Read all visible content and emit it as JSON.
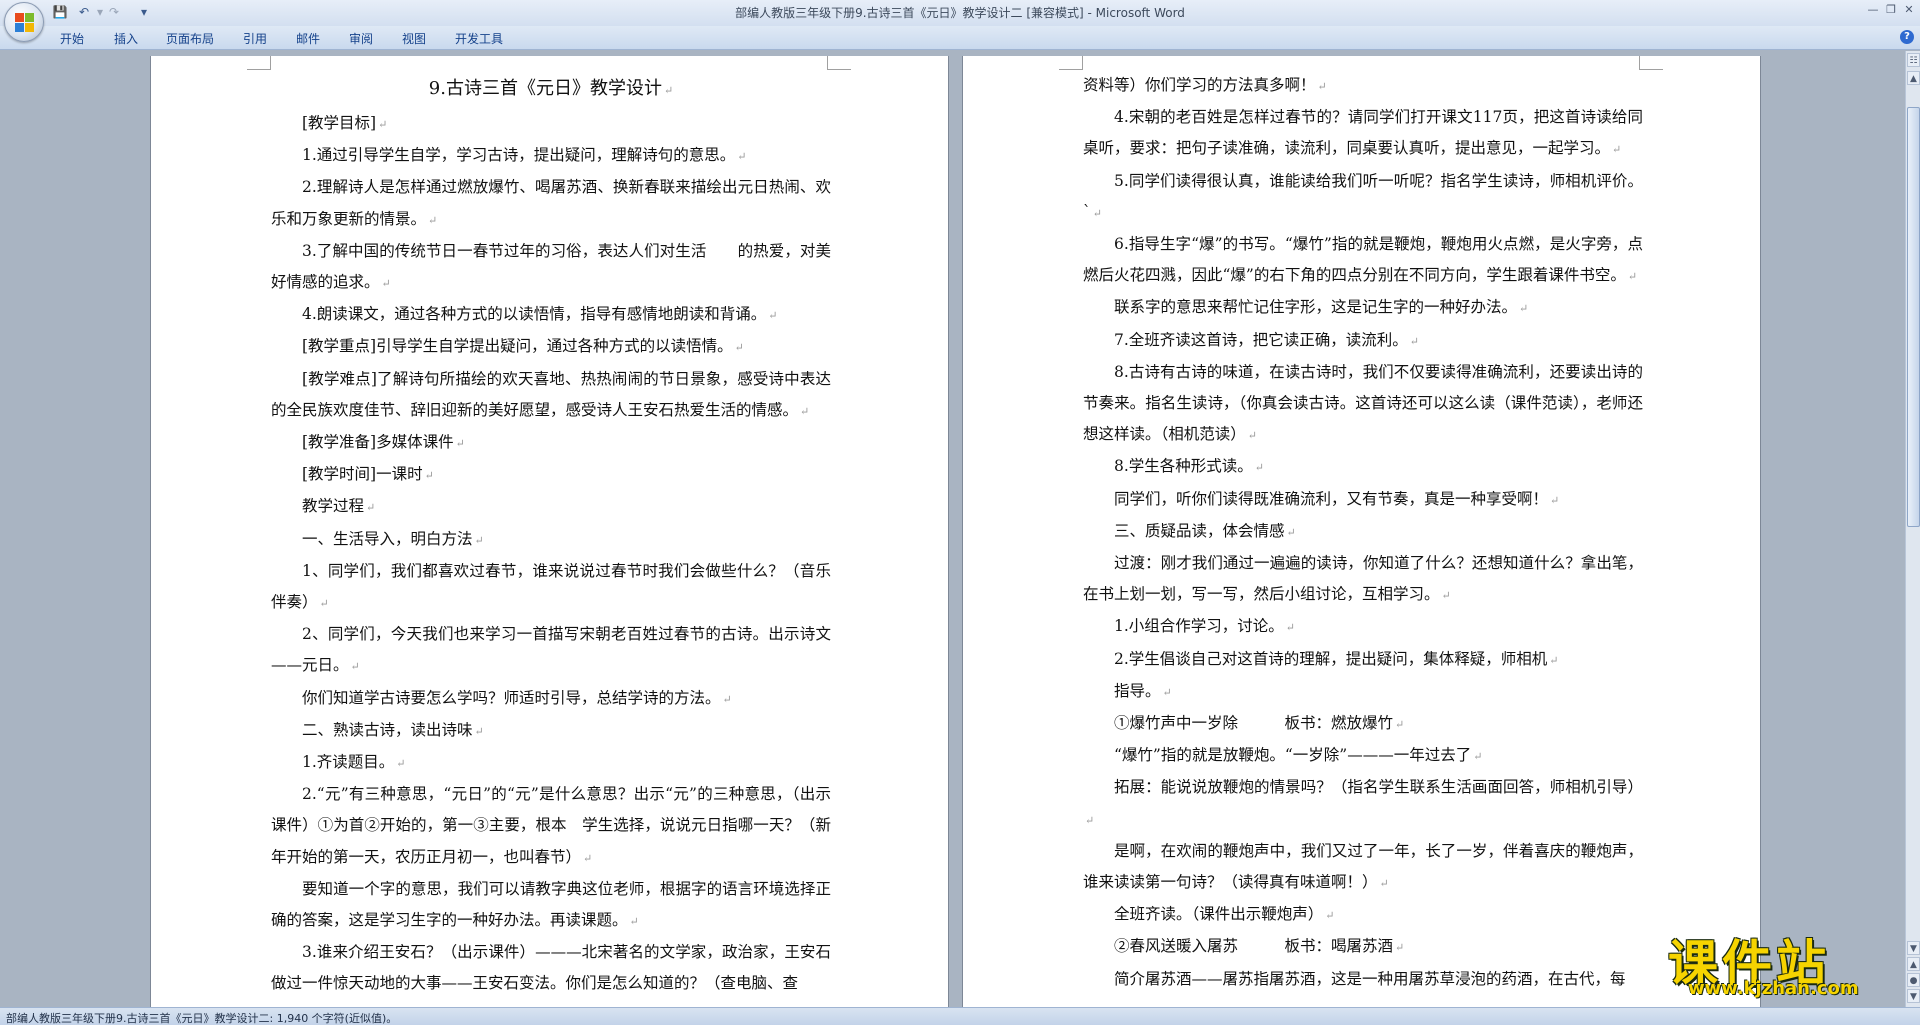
{
  "window": {
    "title": "部编人教版三年级下册9.古诗三首《元日》教学设计二 [兼容模式] - Microsoft Word"
  },
  "quick_access": [
    "save-icon",
    "undo-icon",
    "redo-icon",
    "customize-icon"
  ],
  "ribbon": {
    "tabs": [
      "开始",
      "插入",
      "页面布局",
      "引用",
      "邮件",
      "审阅",
      "视图",
      "开发工具"
    ]
  },
  "left_page": {
    "paragraphs": [
      {
        "style": "title",
        "text": "9.古诗三首《元日》教学设计"
      },
      {
        "style": "indent",
        "text": "[教学目标]"
      },
      {
        "style": "indent",
        "text": "1.通过引导学生自学，学习古诗，提出疑问，理解诗句的意思。"
      },
      {
        "style": "indent",
        "text": "2.理解诗人是怎样通过燃放爆竹、喝屠苏酒、换新春联来描绘出元日热闹、欢乐和万象更新的情景。"
      },
      {
        "style": "indent",
        "text": "3.了解中国的传统节日一春节过年的习俗，表达人们对生活　　的热爱，对美好情感的追求。"
      },
      {
        "style": "indent",
        "text": "4.朗读课文，通过各种方式的以读悟情，指导有感情地朗读和背诵。"
      },
      {
        "style": "indent",
        "text": "[教学重点]引导学生自学提出疑问，通过各种方式的以读悟情。"
      },
      {
        "style": "indent",
        "text": "[教学难点]了解诗句所描绘的欢天喜地、热热闹闹的节日景象，感受诗中表达的全民族欢度佳节、辞旧迎新的美好愿望，感受诗人王安石热爱生活的情感。"
      },
      {
        "style": "indent",
        "text": "[教学准备]多媒体课件"
      },
      {
        "style": "indent",
        "text": "[教学时间]一课时"
      },
      {
        "style": "indent",
        "text": "教学过程"
      },
      {
        "style": "indent",
        "text": "一、生活导入，明白方法"
      },
      {
        "style": "indent",
        "text": "1、同学们，我们都喜欢过春节，谁来说说过春节时我们会做些什么？（音乐伴奏）"
      },
      {
        "style": "indent",
        "text": "2、同学们，今天我们也来学习一首描写宋朝老百姓过春节的古诗。出示诗文——元日。"
      },
      {
        "style": "indent",
        "text": "你们知道学古诗要怎么学吗？师适时引导，总结学诗的方法。"
      },
      {
        "style": "indent",
        "text": "二、熟读古诗，读出诗味"
      },
      {
        "style": "indent",
        "text": "1.齐读题目。"
      },
      {
        "style": "indent",
        "text": "2.“元”有三种意思，“元日”的“元”是什么意思？出示“元”的三种意思，（出示课件）①为首②开始的，第一③主要，根本　学生选择，说说元日指哪一天？（新年开始的第一天，农历正月初一，也叫春节）"
      },
      {
        "style": "indent",
        "text": "要知道一个字的意思，我们可以请教字典这位老师，根据字的语言环境选择正确的答案，这是学习生字的一种好办法。再读课题。"
      },
      {
        "style": "indent-open",
        "text": "3.谁来介绍王安石？（出示课件）———北宋著名的文学家，政治家，王安石做过一件惊天动地的大事——王安石变法。你们是怎么知道的？（查电脑、查"
      }
    ]
  },
  "right_page": {
    "paragraphs": [
      {
        "style": "noind",
        "text": "资料等）你们学习的方法真多啊！"
      },
      {
        "style": "indent",
        "text": "4.宋朝的老百姓是怎样过春节的？请同学们打开课文117页，把这首诗读给同桌听，要求：把句子读准确，读流利，同桌要认真听，提出意见，一起学习。"
      },
      {
        "style": "indent",
        "text": "5.同学们读得很认真，谁能读给我们听一听呢？指名学生读诗，师相机评价。`"
      },
      {
        "style": "indent",
        "text": "6.指导生字“爆”的书写。“爆竹”指的就是鞭炮，鞭炮用火点燃，是火字旁，点燃后火花四溅，因此“爆”的右下角的四点分别在不同方向，学生跟着课件书空。"
      },
      {
        "style": "indent",
        "text": "联系字的意思来帮忙记住字形，这是记生字的一种好办法。"
      },
      {
        "style": "indent",
        "text": "7.全班齐读这首诗，把它读正确，读流利。"
      },
      {
        "style": "indent",
        "text": "8.古诗有古诗的味道，在读古诗时，我们不仅要读得准确流利，还要读出诗的节奏来。指名生读诗，（你真会读古诗。这首诗还可以这么读（课件范读），老师还想这样读。（相机范读）"
      },
      {
        "style": "indent",
        "text": "8.学生各种形式读。"
      },
      {
        "style": "indent",
        "text": "同学们，听你们读得既准确流利，又有节奏，真是一种享受啊！"
      },
      {
        "style": "indent",
        "text": "三、质疑品读，体会情感"
      },
      {
        "style": "indent",
        "text": "过渡：刚才我们通过一遍遍的读诗，你知道了什么？还想知道什么？拿出笔，在书上划一划，写一写，然后小组讨论，互相学习。"
      },
      {
        "style": "indent",
        "text": "1.小组合作学习，讨论。"
      },
      {
        "style": "indent",
        "text": "2.学生倡谈自己对这首诗的理解，提出疑问，集体释疑，师相机"
      },
      {
        "style": "indent",
        "text": "指导。"
      },
      {
        "style": "indent",
        "text": "①爆竹声中一岁除　　　板书：燃放爆竹"
      },
      {
        "style": "indent",
        "text": "“爆竹”指的就是放鞭炮。“一岁除”———一年过去了"
      },
      {
        "style": "indent",
        "text": "拓展：能说说放鞭炮的情景吗？（指名学生联系生活画面回答，师相机引导）"
      },
      {
        "style": "indent",
        "text": "是啊，在欢闹的鞭炮声中，我们又过了一年，长了一岁，伴着喜庆的鞭炮声，谁来读读第一句诗？（读得真有味道啊！）"
      },
      {
        "style": "indent",
        "text": "全班齐读。（课件出示鞭炮声）"
      },
      {
        "style": "indent",
        "text": "②春风送暖入屠苏　　　板书：喝屠苏酒"
      },
      {
        "style": "indent-open",
        "text": "简介屠苏酒——屠苏指屠苏酒，这是一种用屠苏草浸泡的药酒，在古代，每"
      }
    ]
  },
  "status_bar": {
    "text": "部编人教版三年级下册9.古诗三首《元日》教学设计二: 1,940 个字符(近似值)。"
  },
  "watermark": {
    "main": "课件站",
    "url": "www.kjzhan.com"
  },
  "colors": {
    "ribbon_text": "#15428b",
    "workspace": "#a9b4c2",
    "watermark": "#f6d400"
  }
}
